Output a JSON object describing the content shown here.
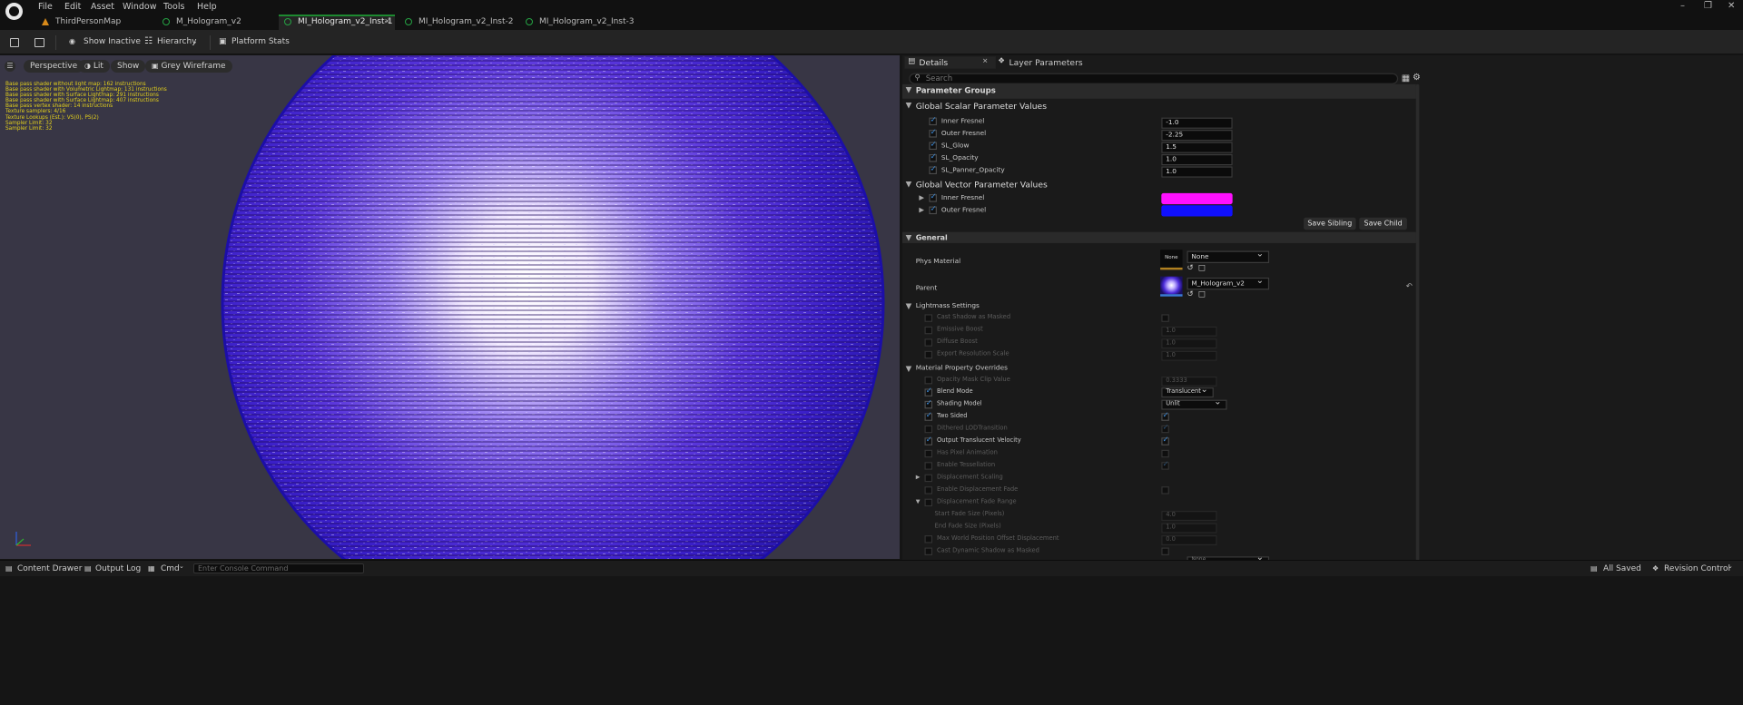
{
  "menu": [
    "File",
    "Edit",
    "Asset",
    "Window",
    "Tools",
    "Help"
  ],
  "tabs": [
    "ThirdPersonMap",
    "M_Hologram_v2",
    "MI_Hologram_v2_Inst-1",
    "MI_Hologram_v2_Inst-2",
    "MI_Hologram_v2_Inst-3"
  ],
  "toolbar": {
    "show_inactive": "Show Inactive",
    "hierarchy": "Hierarchy",
    "platform_stats": "Platform Stats"
  },
  "viewport": {
    "perspective": "Perspective",
    "lit": "Lit",
    "show": "Show",
    "grey_wireframe": "Grey Wireframe",
    "stats": [
      "Base pass shader without light map: 162 instructions",
      "Base pass shader with Volumetric Lightmap: 131 instructions",
      "Base pass shader with Surface Lightmap: 291 instructions",
      "Base pass shader with Surface Lightmap: 407 instructions",
      "Base pass vertex shader: 14 instructions",
      "Texture samplers: 4/16",
      "Texture Lookups (Est.): VS(0), PS(2)",
      "Sampler Limit: 32",
      "Sampler Limit: 32"
    ]
  },
  "status": {
    "content_drawer": "Content Drawer",
    "output_log": "Output Log",
    "cmd": "Cmd",
    "console_placeholder": "Enter Console Command",
    "all_saved": "All Saved",
    "revision_control": "Revision Control"
  },
  "details": {
    "tab_details": "Details",
    "tab_layer": "Layer Parameters",
    "search_placeholder": "Search",
    "parameter_groups": "Parameter Groups",
    "scalar_header": "Global Scalar Parameter Values",
    "scalar": [
      {
        "name": "Inner Fresnel",
        "value": "-1.0"
      },
      {
        "name": "Outer Fresnel",
        "value": "-2.25"
      },
      {
        "name": "SL_Glow",
        "value": "1.5"
      },
      {
        "name": "SL_Opacity",
        "value": "1.0"
      },
      {
        "name": "SL_Panner_Opacity",
        "value": "1.0"
      }
    ],
    "vector_header": "Global Vector Parameter Values",
    "vector": [
      {
        "name": "Inner Fresnel",
        "color": "#ff10ff"
      },
      {
        "name": "Outer Fresnel",
        "color": "#1010ff"
      }
    ],
    "save_sibling": "Save Sibling",
    "save_child": "Save Child",
    "general": "General",
    "phys_material": "Phys Material",
    "phys_value": "None",
    "phys_thumb": "None",
    "parent": "Parent",
    "parent_value": "M_Hologram_v2",
    "lightmass": "Lightmass Settings",
    "lightmass_rows": [
      {
        "name": "Cast Shadow as Masked",
        "value": ""
      },
      {
        "name": "Emissive Boost",
        "value": "1.0"
      },
      {
        "name": "Diffuse Boost",
        "value": "1.0"
      },
      {
        "name": "Export Resolution Scale",
        "value": "1.0"
      }
    ],
    "mpo": "Material Property Overrides",
    "opacity_mask": {
      "name": "Opacity Mask Clip Value",
      "value": "0.3333"
    },
    "blend_mode": {
      "name": "Blend Mode",
      "value": "Translucent"
    },
    "shading_model": {
      "name": "Shading Model",
      "value": "Unlit"
    },
    "bool_rows": [
      "Two Sided",
      "Dithered LODTransition",
      "Output Translucent Velocity",
      "Has Pixel Animation",
      "Enable Tessellation"
    ],
    "displacement_scaling": "Displacement Scaling",
    "enable_disp_fade": "Enable Displacement Fade",
    "disp_fade_range": "Displacement Fade Range",
    "start_fade": {
      "name": "Start Fade Size (Pixels)",
      "value": "4.0"
    },
    "end_fade": {
      "name": "End Fade Size (Pixels)",
      "value": "1.0"
    },
    "max_wpo": {
      "name": "Max World Position Offset Displacement",
      "value": "0.0"
    },
    "cast_dyn": "Cast Dynamic Shadow as Masked",
    "last_dropdown": "None"
  }
}
